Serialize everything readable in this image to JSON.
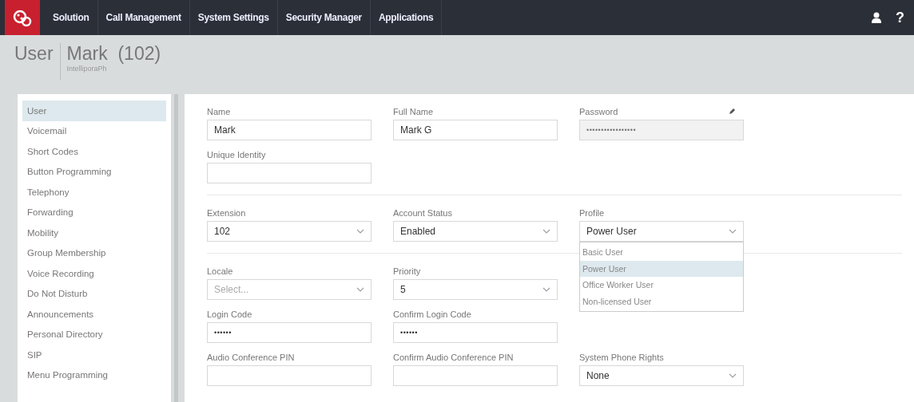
{
  "top_nav": {
    "items": [
      {
        "label": "Solution"
      },
      {
        "label": "Call Management"
      },
      {
        "label": "System Settings"
      },
      {
        "label": "Security Manager"
      },
      {
        "label": "Applications"
      }
    ],
    "help": "?"
  },
  "page_header": {
    "section": "User",
    "title": "Mark  (102)",
    "subtitle": "IntelliporaPh"
  },
  "sidebar": {
    "items": [
      {
        "label": "User",
        "selected": true
      },
      {
        "label": "Voicemail",
        "selected": false
      },
      {
        "label": "Short Codes",
        "selected": false
      },
      {
        "label": "Button Programming",
        "selected": false
      },
      {
        "label": "Telephony",
        "selected": false
      },
      {
        "label": "Forwarding",
        "selected": false
      },
      {
        "label": "Mobility",
        "selected": false
      },
      {
        "label": "Group Membership",
        "selected": false
      },
      {
        "label": "Voice Recording",
        "selected": false
      },
      {
        "label": "Do Not Disturb",
        "selected": false
      },
      {
        "label": "Announcements",
        "selected": false
      },
      {
        "label": "Personal Directory",
        "selected": false
      },
      {
        "label": "SIP",
        "selected": false
      },
      {
        "label": "Menu Programming",
        "selected": false
      }
    ]
  },
  "form": {
    "sections": [
      {
        "rows": [
          [
            {
              "kind": "text",
              "label": "Name",
              "value": "Mark"
            },
            {
              "kind": "text",
              "label": "Full Name",
              "value": "Mark G"
            },
            {
              "kind": "password",
              "label": "Password",
              "value": "•••••••••••••••••",
              "disabled": true,
              "editable": true
            }
          ],
          [
            {
              "kind": "text",
              "label": "Unique Identity"
            }
          ]
        ]
      },
      {
        "rows": [
          [
            {
              "kind": "select",
              "label": "Extension",
              "value": "102"
            },
            {
              "kind": "select",
              "label": "Account Status",
              "value": "Enabled"
            },
            {
              "kind": "select",
              "label": "Profile",
              "value": "Power User",
              "expanded": true,
              "options": [
                {
                  "label": "Basic User",
                  "selected": false
                },
                {
                  "label": "Power User",
                  "selected": true
                },
                {
                  "label": "Office Worker User",
                  "selected": false
                },
                {
                  "label": "Non-licensed User",
                  "selected": false
                }
              ]
            }
          ]
        ]
      },
      {
        "rows": [
          [
            {
              "kind": "select",
              "label": "Locale",
              "placeholder": "Select..."
            },
            {
              "kind": "select",
              "label": "Priority",
              "value": "5"
            }
          ],
          [
            {
              "kind": "password",
              "label": "Login Code",
              "value": "••••••"
            },
            {
              "kind": "password",
              "label": "Confirm Login Code",
              "value": "••••••"
            }
          ],
          [
            {
              "kind": "text",
              "label": "Audio Conference PIN"
            },
            {
              "kind": "text",
              "label": "Confirm Audio Conference PIN"
            },
            {
              "kind": "select",
              "label": "System Phone Rights",
              "value": "None"
            }
          ]
        ]
      }
    ]
  }
}
